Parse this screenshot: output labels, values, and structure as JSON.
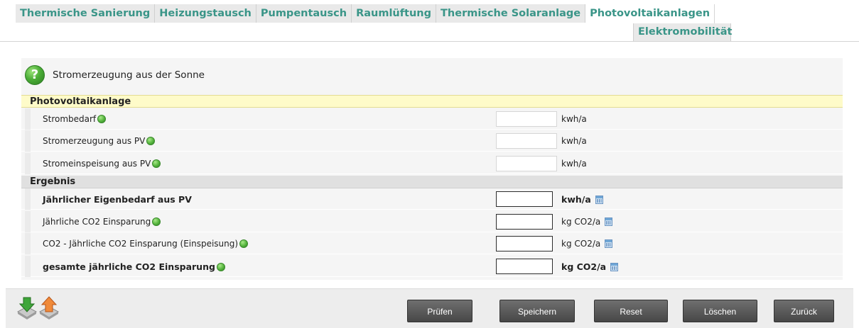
{
  "tabs": {
    "items": [
      {
        "label": "Thermische Sanierung"
      },
      {
        "label": "Heizungstausch"
      },
      {
        "label": "Pumpentausch"
      },
      {
        "label": "Raumlüftung"
      },
      {
        "label": "Thermische Solaranlage"
      },
      {
        "label": "Photovoltaikanlagen"
      }
    ],
    "second_row": {
      "label": "Elektromobilität"
    },
    "active": "Photovoltaikanlagen",
    "color": "#3a9588"
  },
  "header": {
    "title": "Stromerzeugung aus der Sonne",
    "icon": "help-icon"
  },
  "sections": {
    "pv": {
      "title": "Photovoltaikanlage",
      "rows": [
        {
          "label": "Strombedarf",
          "value": "",
          "unit": "kwh/a"
        },
        {
          "label": "Stromerzeugung aus PV",
          "value": "",
          "unit": "kwh/a"
        },
        {
          "label": "Stromeinspeisung aus PV",
          "value": "",
          "unit": "kwh/a"
        }
      ]
    },
    "ergebnis": {
      "title": "Ergebnis",
      "rows": [
        {
          "label": "Jährlicher Eigenbedarf aus PV",
          "value": "",
          "unit": "kwh/a"
        },
        {
          "label": "Jährliche CO2 Einsparung",
          "value": "",
          "unit": "kg CO2/a"
        },
        {
          "label": "CO2 - Jährliche CO2 Einsparung (Einspeisung)",
          "value": "",
          "unit": "kg CO2/a"
        },
        {
          "label": "gesamte jährliche CO2 Einsparung",
          "value": "",
          "unit": "kg CO2/a"
        }
      ]
    }
  },
  "footer": {
    "icons": [
      "download-icon",
      "upload-icon"
    ],
    "buttons": {
      "check": "Prüfen",
      "save": "Speichern",
      "reset": "Reset",
      "delete": "Löschen",
      "back": "Zurück"
    }
  }
}
